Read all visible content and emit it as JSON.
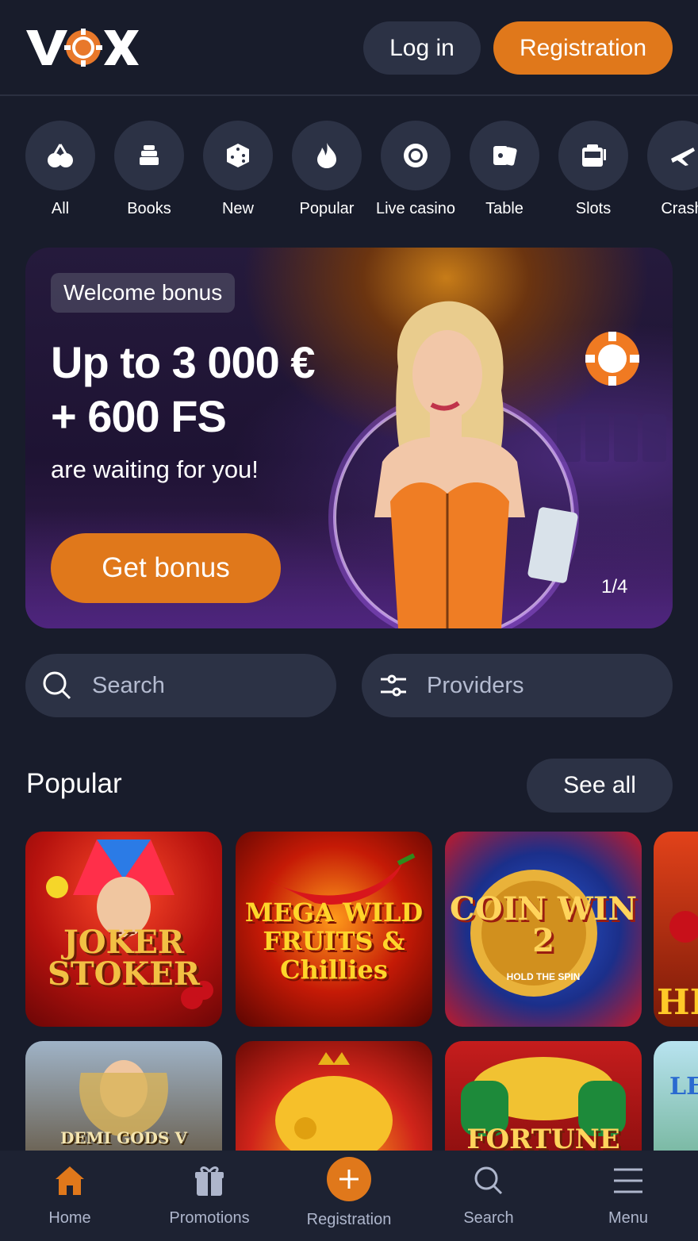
{
  "header": {
    "logo_text": "VOX",
    "login_label": "Log in",
    "registration_label": "Registration"
  },
  "categories": [
    {
      "label": "All",
      "icon": "cherries-icon"
    },
    {
      "label": "Books",
      "icon": "books-icon"
    },
    {
      "label": "New",
      "icon": "dice-icon"
    },
    {
      "label": "Popular",
      "icon": "fire-icon"
    },
    {
      "label": "Live casino",
      "icon": "chip-icon"
    },
    {
      "label": "Table",
      "icon": "cards-icon"
    },
    {
      "label": "Slots",
      "icon": "slot-machine-icon"
    },
    {
      "label": "Crash",
      "icon": "plane-icon"
    }
  ],
  "banner": {
    "tag": "Welcome bonus",
    "headline_line1": "Up to 3 000 €",
    "headline_line2": "+ 600 FS",
    "subtitle": "are waiting for you!",
    "cta": "Get bonus",
    "pager": "1/4"
  },
  "search": {
    "placeholder": "Search",
    "providers_label": "Providers"
  },
  "popular": {
    "title": "Popular",
    "see_all": "See all",
    "games_row1": [
      {
        "title": "JOKER STOKER"
      },
      {
        "title": "MEGA WILD FRUITS & Chillies"
      },
      {
        "title": "COIN WIN 2",
        "subtitle": "HOLD THE SPIN"
      },
      {
        "title": "HI"
      }
    ],
    "games_row2": [
      {
        "title": "DEMI GODS V"
      },
      {
        "title": ""
      },
      {
        "title": "FORTUNE"
      },
      {
        "title": "LE"
      }
    ]
  },
  "bottom_nav": [
    {
      "label": "Home",
      "icon": "home-icon"
    },
    {
      "label": "Promotions",
      "icon": "gift-icon"
    },
    {
      "label": "Registration",
      "icon": "plus-icon"
    },
    {
      "label": "Search",
      "icon": "search-icon"
    },
    {
      "label": "Menu",
      "icon": "menu-icon"
    }
  ],
  "colors": {
    "background": "#181c2b",
    "accent": "#e0781b",
    "surface": "#2c3245",
    "muted_text": "#aeb6cc"
  }
}
